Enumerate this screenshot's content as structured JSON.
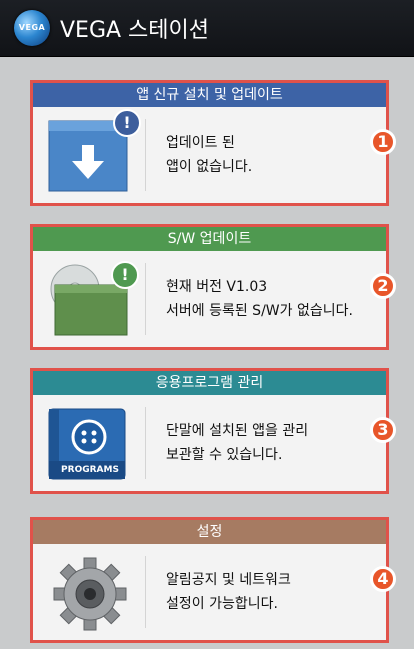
{
  "app": {
    "logo_text": "VEGA",
    "title": "VEGA 스테이션"
  },
  "colors": {
    "card_border": "#e0524a",
    "header_update": "#3d63a6",
    "header_sw": "#4f9950",
    "header_program": "#2c8b93",
    "header_settings": "#a67b62",
    "badge": "#e8562a"
  },
  "cards": [
    {
      "header": "앱 신규 설치 및 업데이트",
      "icon": "download-icon",
      "text_line1": "업데이트 된",
      "text_line2": "앱이 없습니다.",
      "badge": "1"
    },
    {
      "header": "S/W 업데이트",
      "icon": "software-package-icon",
      "text_line1": "현재 버전 V1.03",
      "text_line2": "서버에 등록된 S/W가 없습니다.",
      "badge": "2"
    },
    {
      "header": "응용프로그램 관리",
      "icon": "programs-icon",
      "icon_label": "PROGRAMS",
      "text_line1": "단말에 설치된 앱을 관리",
      "text_line2": "보관할 수 있습니다.",
      "badge": "3"
    },
    {
      "header": "설정",
      "icon": "gear-icon",
      "text_line1": "알림공지 및 네트워크",
      "text_line2": "설정이 가능합니다.",
      "badge": "4"
    }
  ]
}
